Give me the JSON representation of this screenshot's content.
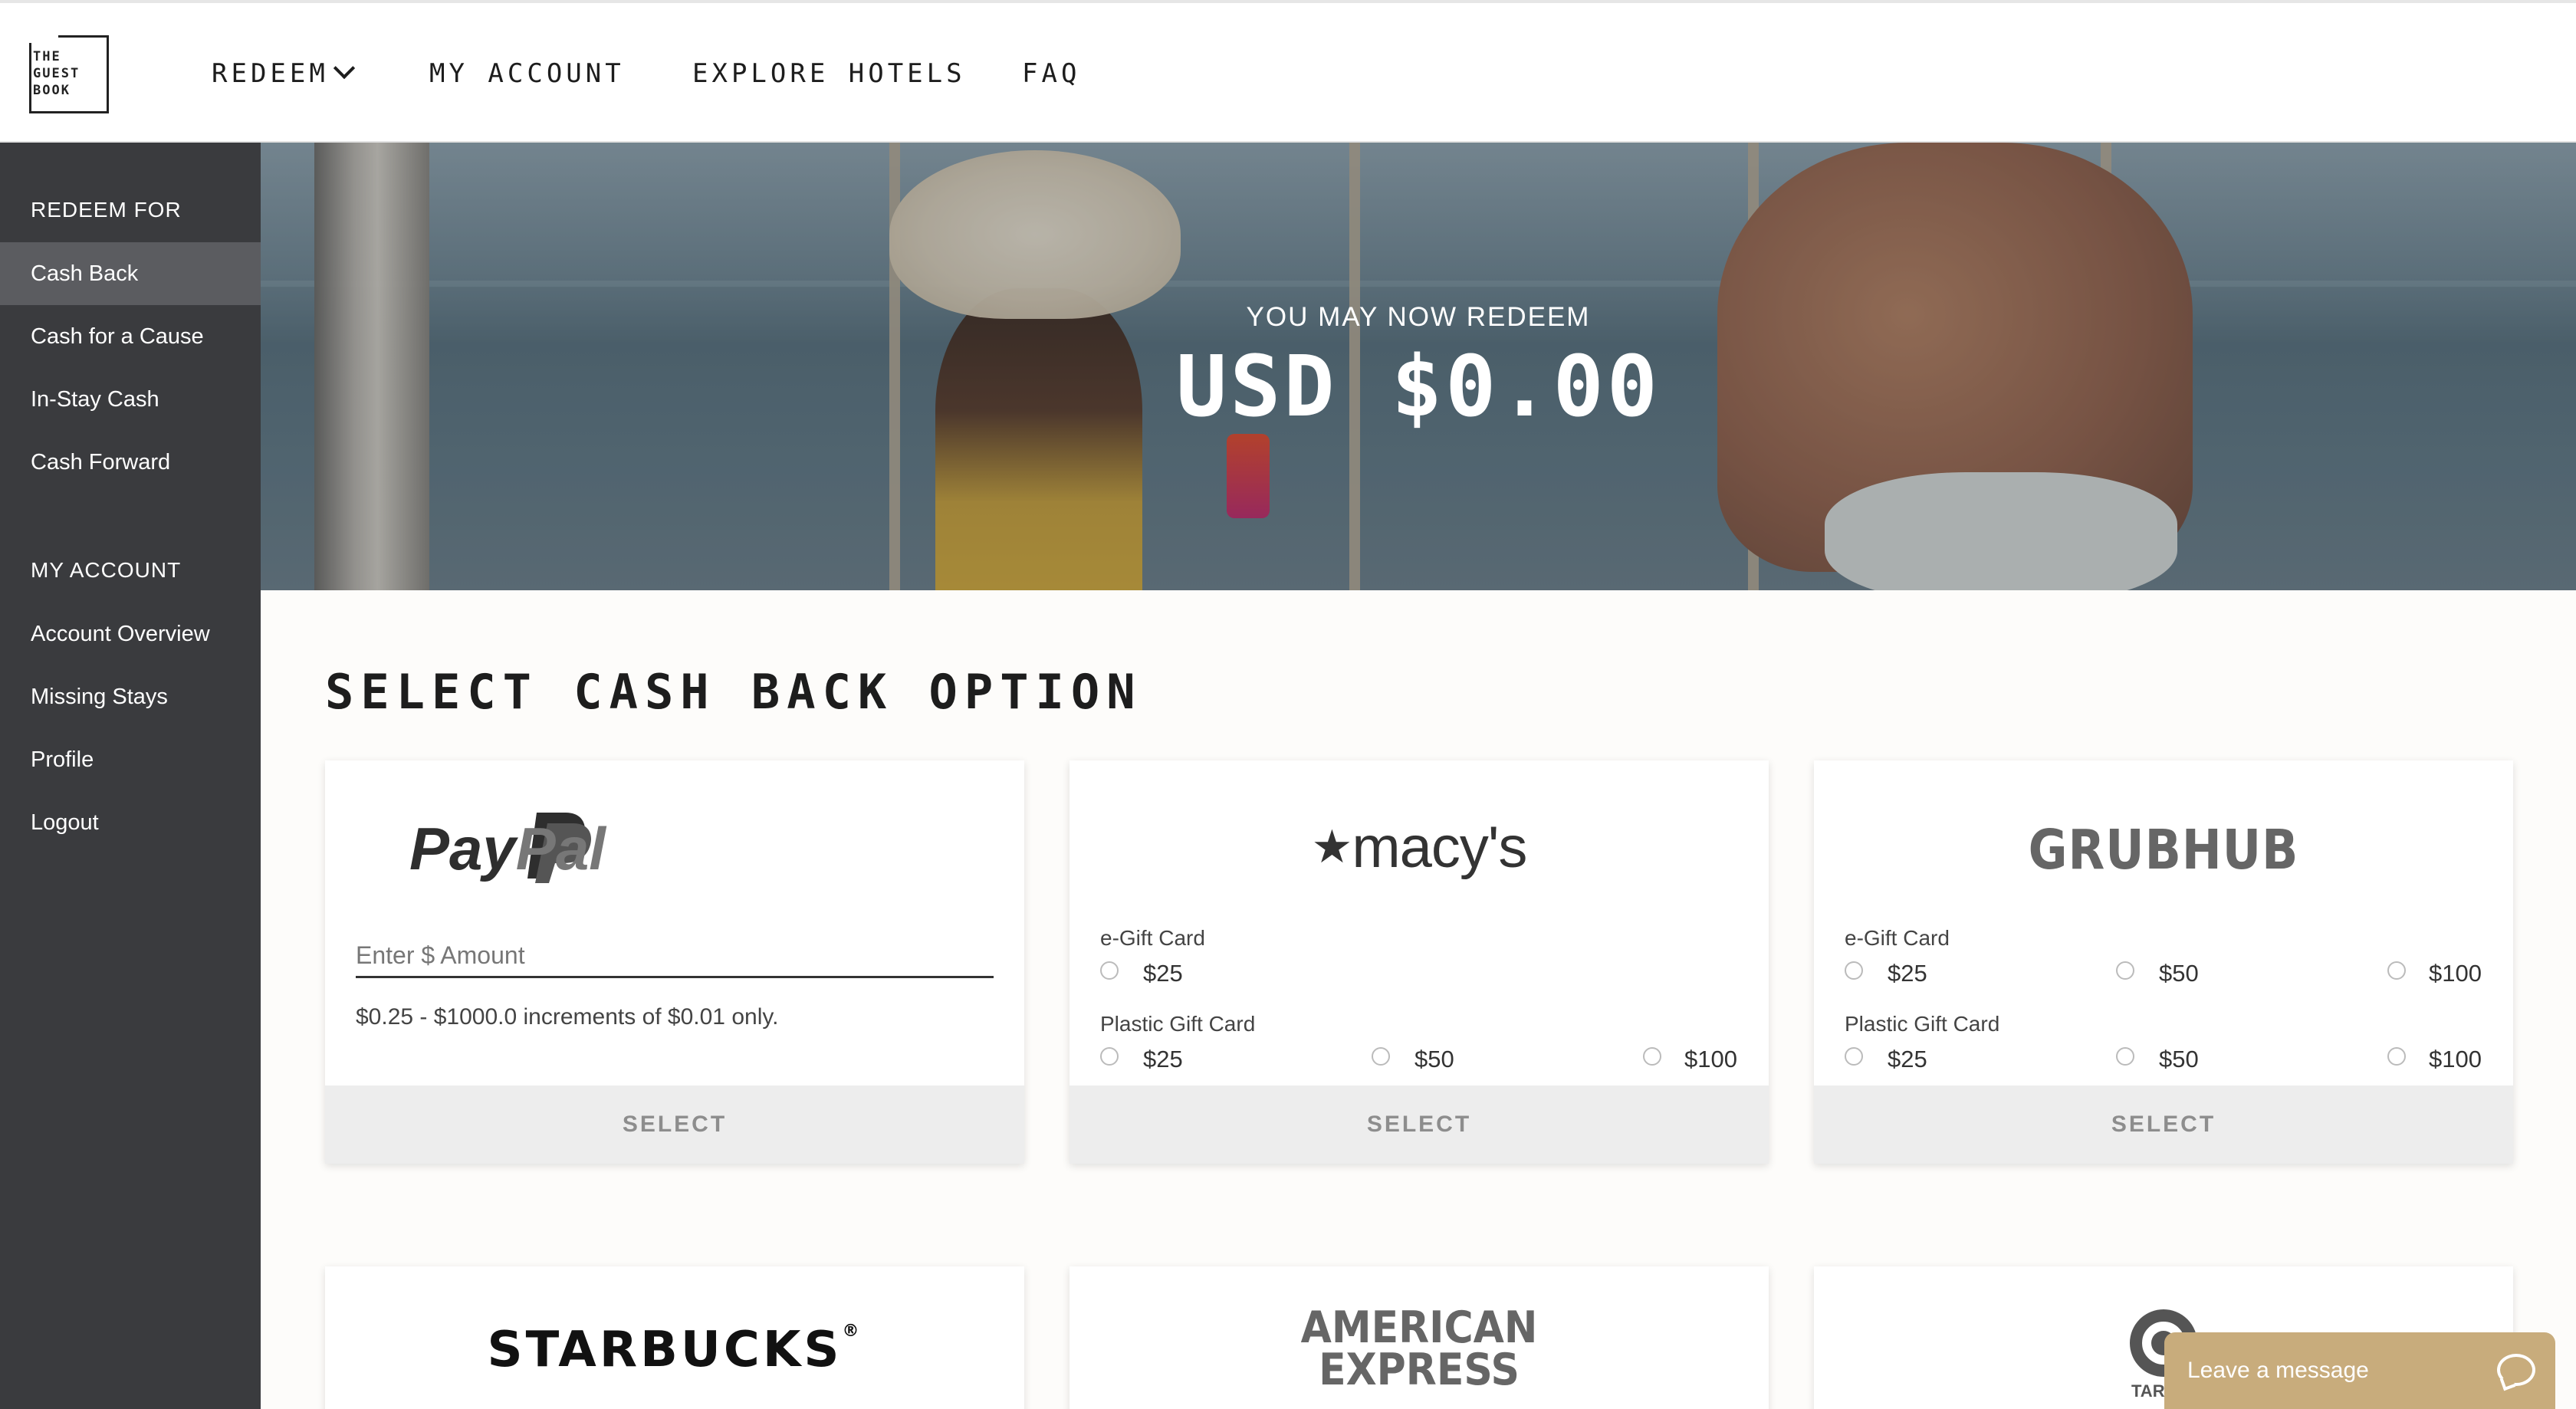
{
  "header": {
    "logo_lines": [
      "THE",
      "GUEST",
      "BOOK"
    ],
    "nav": [
      {
        "label": "REDEEM"
      },
      {
        "label": "MY ACCOUNT"
      },
      {
        "label": "EXPLORE HOTELS"
      },
      {
        "label": "FAQ"
      }
    ]
  },
  "sidebar": {
    "redeem_heading": "REDEEM FOR",
    "redeem_items": [
      {
        "label": "Cash Back",
        "active": true
      },
      {
        "label": "Cash for a Cause"
      },
      {
        "label": "In-Stay Cash"
      },
      {
        "label": "Cash Forward"
      }
    ],
    "account_heading": "MY ACCOUNT",
    "account_items": [
      {
        "label": "Account Overview"
      },
      {
        "label": "Missing Stays"
      },
      {
        "label": "Profile"
      },
      {
        "label": "Logout"
      }
    ]
  },
  "hero": {
    "subtitle": "YOU MAY NOW REDEEM",
    "amount": "USD $0.00"
  },
  "main": {
    "title": "SELECT CASH BACK OPTION",
    "cards": [
      {
        "brand": "PayPal",
        "brand_prefix": "Pay",
        "brand_suffix": "Pal",
        "amount_placeholder": "Enter $ Amount",
        "hint": "$0.25 - $1000.0 increments of $0.01 only.",
        "select": "SELECT"
      },
      {
        "brand": "macy's",
        "egift_label": "e-Gift Card",
        "egift_options": [
          "$25"
        ],
        "plastic_label": "Plastic Gift Card",
        "plastic_options": [
          "$25",
          "$50",
          "$100"
        ],
        "select": "SELECT"
      },
      {
        "brand": "GRUBHUB",
        "egift_label": "e-Gift Card",
        "egift_options": [
          "$25",
          "$50",
          "$100"
        ],
        "plastic_label": "Plastic Gift Card",
        "plastic_options": [
          "$25",
          "$50",
          "$100"
        ],
        "select": "SELECT"
      },
      {
        "brand": "STARBUCKS",
        "reg": "®"
      },
      {
        "brand_line1": "AMERICAN",
        "brand_line2": "EXPRESS"
      },
      {
        "brand": "TARG"
      }
    ]
  },
  "chat": {
    "label": "Leave a message"
  },
  "colors": {
    "sidebar_bg": "#3a3b3e",
    "sidebar_active": "#5b5c60",
    "select_bg": "#ededed",
    "chat_bg": "#c8ac7c"
  }
}
